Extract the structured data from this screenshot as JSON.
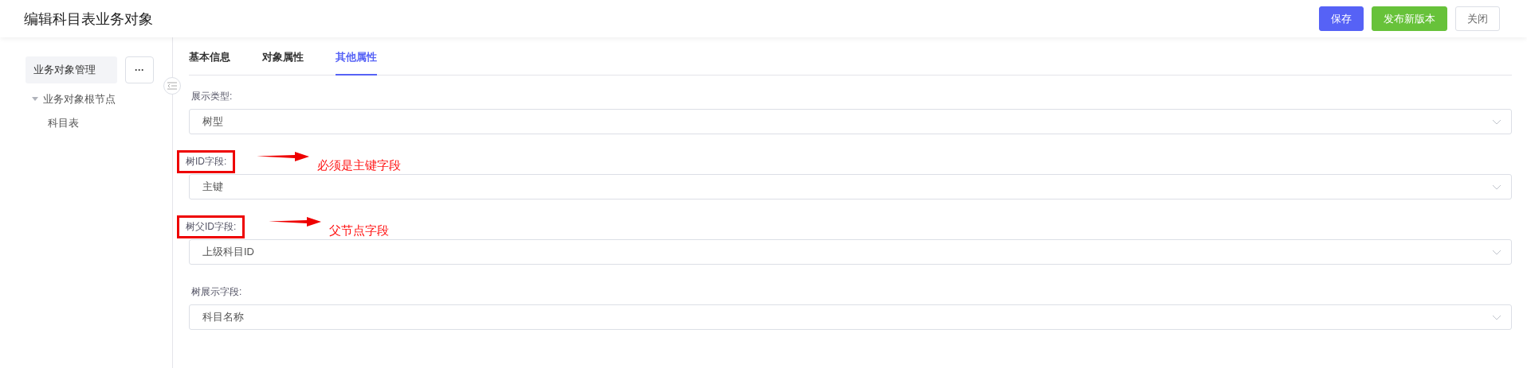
{
  "header": {
    "title": "编辑科目表业务对象",
    "buttons": [
      {
        "kind": "primary",
        "label": "保存"
      },
      {
        "kind": "success",
        "label": "发布新版本"
      },
      {
        "kind": "default",
        "label": "关闭"
      }
    ]
  },
  "sidebar": {
    "title": "业务对象管理",
    "more": "···",
    "tree": [
      {
        "label": "业务对象根节点",
        "expanded": true,
        "children": [
          {
            "label": "科目表"
          }
        ]
      }
    ]
  },
  "tabs": [
    {
      "label": "基本信息",
      "selected": false
    },
    {
      "label": "对象属性",
      "selected": false
    },
    {
      "label": "其他属性",
      "selected": true
    }
  ],
  "fields": [
    {
      "label": "展示类型:",
      "value": "树型",
      "highlighted": false
    },
    {
      "label": "树ID字段:",
      "value": "主键",
      "highlighted": true,
      "note": "必须是主键字段"
    },
    {
      "label": "树父ID字段:",
      "value": "上级科目ID",
      "highlighted": true,
      "note": "父节点字段"
    },
    {
      "label": "树展示字段:",
      "value": "科目名称",
      "highlighted": false
    }
  ]
}
